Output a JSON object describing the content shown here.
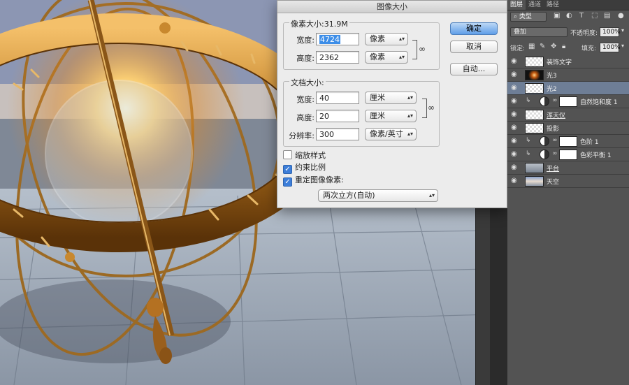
{
  "dialog": {
    "title": "图像大小",
    "pixel_dimensions": {
      "label": "像素大小:31.9M",
      "width_label": "宽度:",
      "width_value": "4724",
      "width_unit": "像素",
      "height_label": "高度:",
      "height_value": "2362",
      "height_unit": "像素"
    },
    "document_size": {
      "label": "文档大小:",
      "width_label": "宽度:",
      "width_value": "40",
      "width_unit": "厘米",
      "height_label": "高度:",
      "height_value": "20",
      "height_unit": "厘米",
      "resolution_label": "分辨率:",
      "resolution_value": "300",
      "resolution_unit": "像素/英寸"
    },
    "checkboxes": [
      {
        "label": "缩放样式",
        "checked": false
      },
      {
        "label": "约束比例",
        "checked": true
      },
      {
        "label": "重定图像像素:",
        "checked": true
      }
    ],
    "resample_method": "两次立方(自动)",
    "buttons": {
      "ok": "确定",
      "cancel": "取消",
      "auto": "自动..."
    }
  },
  "layers_panel": {
    "tabs": [
      "图层",
      "通道",
      "路径"
    ],
    "filter_kind": "类型",
    "blend_mode": "叠加",
    "opacity_label": "不透明度:",
    "opacity_value": "100%",
    "lock_label": "锁定:",
    "fill_label": "填充:",
    "fill_value": "100%",
    "layers": [
      {
        "name": "装饰文字",
        "thumb": "checker",
        "selected": false,
        "type": "pixel",
        "underline": false
      },
      {
        "name": "光3",
        "thumb": "dark",
        "selected": false,
        "type": "pixel",
        "underline": false
      },
      {
        "name": "光2",
        "thumb": "checker",
        "selected": true,
        "type": "pixel",
        "underline": false
      },
      {
        "name": "自然饱和度 1",
        "thumb": "white",
        "selected": false,
        "type": "adjustment",
        "underline": false
      },
      {
        "name": "浑天仪",
        "thumb": "checker",
        "selected": false,
        "type": "pixel",
        "underline": true
      },
      {
        "name": "投影",
        "thumb": "checker",
        "selected": false,
        "type": "pixel",
        "underline": false
      },
      {
        "name": "色阶 1",
        "thumb": "white",
        "selected": false,
        "type": "adjustment",
        "underline": false
      },
      {
        "name": "色彩平衡 1",
        "thumb": "white",
        "selected": false,
        "type": "adjustment",
        "underline": false
      },
      {
        "name": "平台",
        "thumb": "plat",
        "selected": false,
        "type": "pixel",
        "underline": true
      },
      {
        "name": "天空",
        "thumb": "sky",
        "selected": false,
        "type": "pixel",
        "underline": false
      }
    ]
  },
  "colors": {
    "accent": "#3d8ee8",
    "panel_bg": "#535353",
    "selected_layer": "#6e7e96",
    "dialog_bg": "#ececec"
  }
}
